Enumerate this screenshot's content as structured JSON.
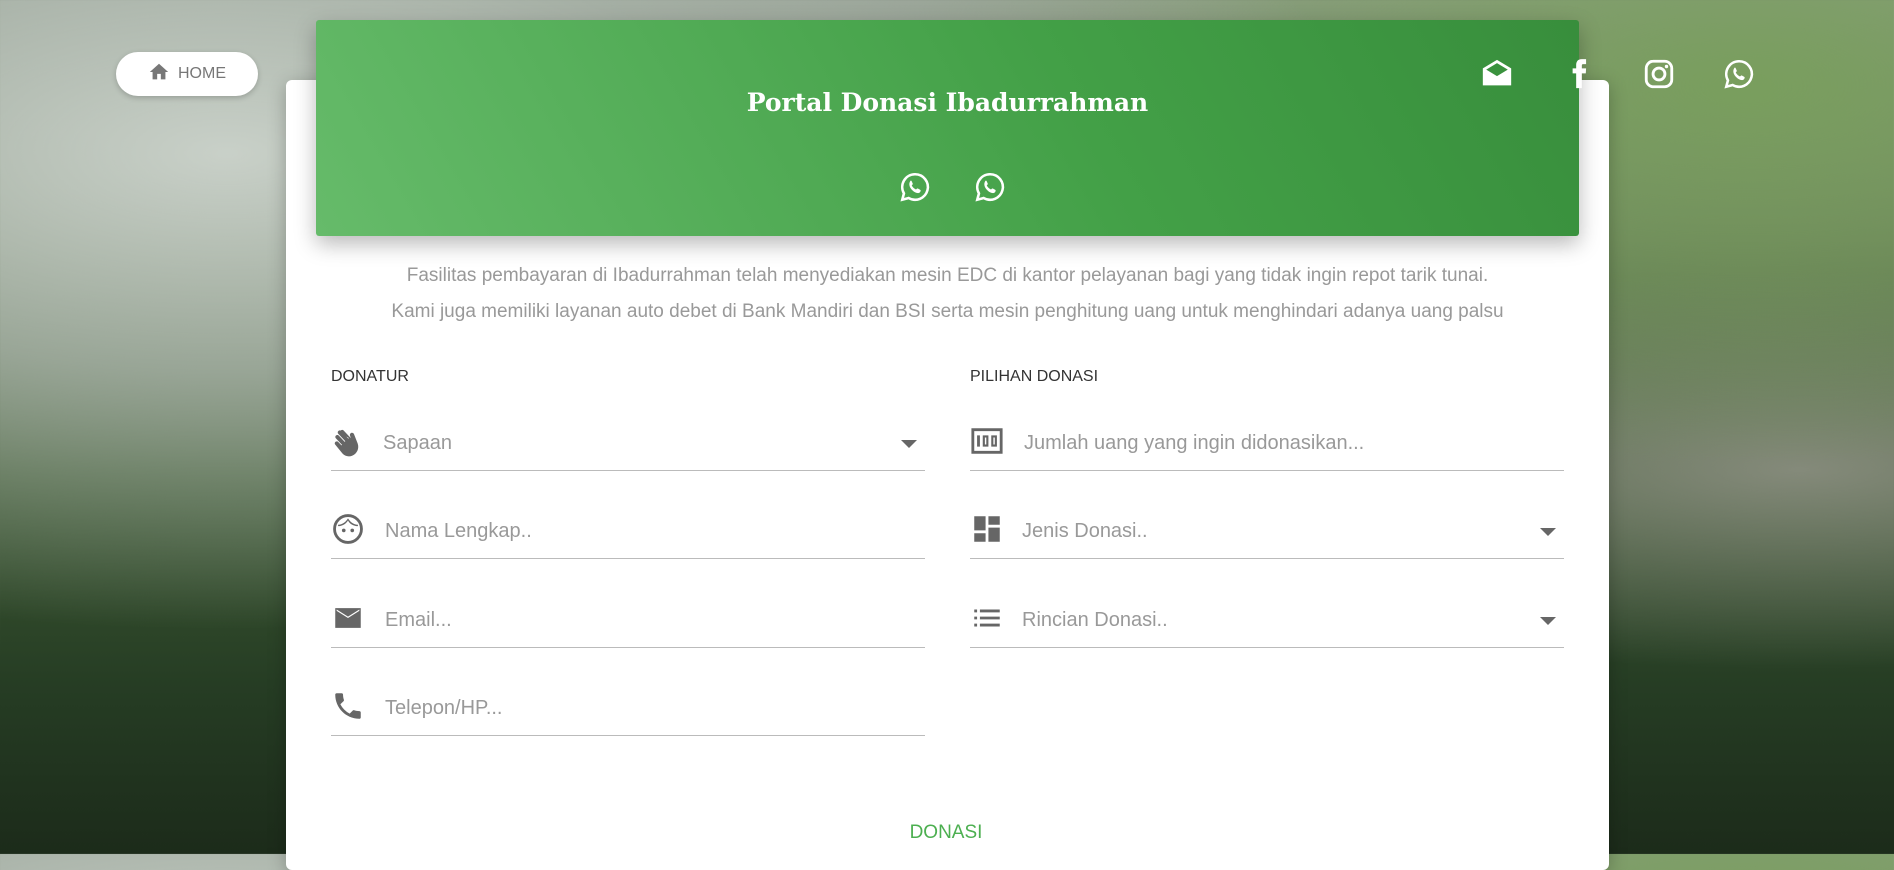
{
  "nav": {
    "home_label": "HOME",
    "home_icon": "home-icon"
  },
  "header": {
    "title": "Portal Donasi Ibadurrahman",
    "whatsapp_icons": [
      "whatsapp-icon",
      "whatsapp-icon"
    ],
    "social_icons": [
      "envelope-open-icon",
      "facebook-icon",
      "instagram-icon",
      "whatsapp-icon"
    ],
    "background_color": "#4caf50"
  },
  "description": {
    "line1": "Fasilitas pembayaran di Ibadurrahman telah menyediakan mesin EDC di kantor pelayanan bagi yang tidak ingin repot tarik tunai.",
    "line2": "Kami juga memiliki layanan auto debet di Bank Mandiri dan BSI serta mesin penghitung uang untuk menghindari adanya uang palsu"
  },
  "donatur": {
    "label": "DONATUR",
    "fields": [
      {
        "icon": "waving-hand-icon",
        "placeholder": "Sapaan",
        "type": "select"
      },
      {
        "icon": "face-icon",
        "placeholder": "Nama Lengkap..",
        "type": "text"
      },
      {
        "icon": "email-icon",
        "placeholder": "Email...",
        "type": "text"
      },
      {
        "icon": "phone-icon",
        "placeholder": "Telepon/HP...",
        "type": "text"
      }
    ]
  },
  "pilihan": {
    "label": "PILIHAN DONASI",
    "fields": [
      {
        "icon": "money-icon",
        "placeholder": "Jumlah uang yang ingin didonasikan...",
        "type": "text"
      },
      {
        "icon": "dashboard-icon",
        "placeholder": "Jenis Donasi..",
        "type": "select"
      },
      {
        "icon": "list-icon",
        "placeholder": "Rincian Donasi..",
        "type": "select"
      }
    ]
  },
  "submit": {
    "label": "DONASI",
    "color": "#4caf50"
  }
}
